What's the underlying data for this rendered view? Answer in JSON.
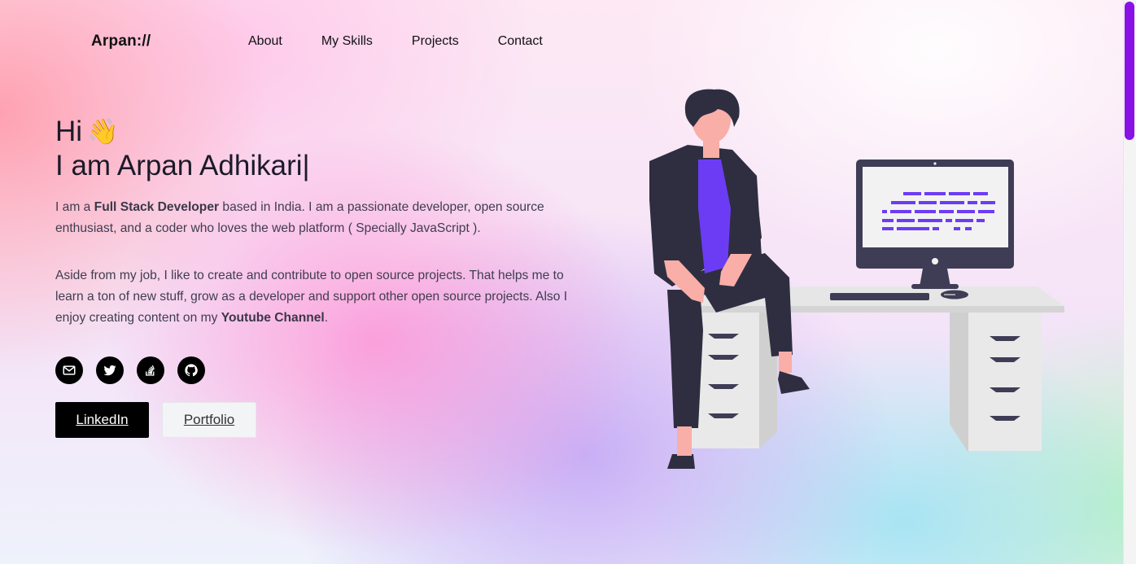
{
  "brand": "Arpan://",
  "nav": {
    "items": [
      "About",
      "My Skills",
      "Projects",
      "Contact"
    ]
  },
  "hero": {
    "greeting": "Hi",
    "wave_emoji": "👋",
    "name": "I am Arpan Adhikari",
    "caret": "|",
    "intro": {
      "pre": "I am a ",
      "role": "Full Stack Developer",
      "post": " based in India. I am a passionate developer, open source enthusiast, and a coder who loves the web platform ( Specially JavaScript )."
    },
    "about": {
      "pre": "Aside from my job, I like to create and contribute to open source projects. That helps me to learn a ton of new stuff, grow as a developer and support other open source projects. Also I enjoy creating content on my ",
      "channel": "Youtube Channel",
      "post": "."
    }
  },
  "socials": [
    {
      "icon": "mail-icon"
    },
    {
      "icon": "twitter-icon"
    },
    {
      "icon": "stackoverflow-icon"
    },
    {
      "icon": "github-icon"
    }
  ],
  "buttons": {
    "linkedin": "LinkedIn",
    "portfolio": "Portfolio"
  },
  "colors": {
    "accent": "#6c3cf5",
    "scrollbar": "#8a11e6",
    "dark": "#000000"
  }
}
